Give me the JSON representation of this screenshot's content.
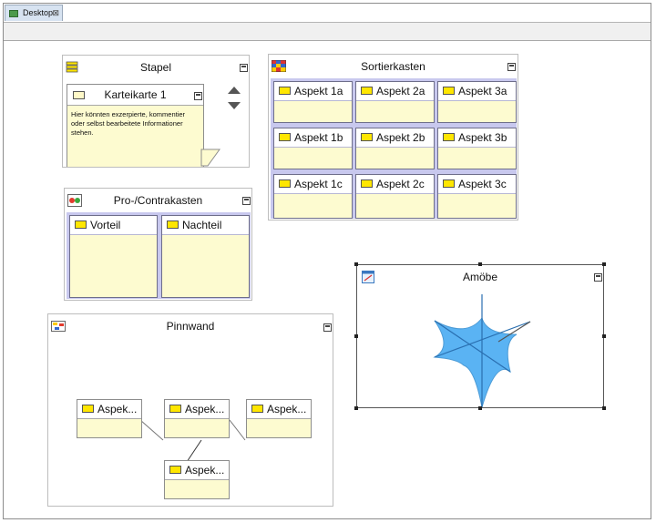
{
  "tab": {
    "label": "Desktop",
    "close": "⊠"
  },
  "stapel": {
    "title": "Stapel",
    "card_title": "Karteikarte 1",
    "card_text_lines": [
      "Hier könnten exzerpierte, kommentier",
      "oder selbst bearbeitete Informationer",
      "stehen."
    ]
  },
  "sortierkasten": {
    "title": "Sortierkasten",
    "cells": [
      [
        "Aspekt 1a",
        "Aspekt 2a",
        "Aspekt 3a"
      ],
      [
        "Aspekt 1b",
        "Aspekt 2b",
        "Aspekt 3b"
      ],
      [
        "Aspekt 1c",
        "Aspekt 2c",
        "Aspekt 3c"
      ]
    ]
  },
  "procontra": {
    "title": "Pro-/Contrakasten",
    "pro": "Vorteil",
    "contra": "Nachteil"
  },
  "pinnwand": {
    "title": "Pinnwand",
    "cards": [
      "Aspek...",
      "Aspek...",
      "Aspek...",
      "Aspek..."
    ]
  },
  "amoebe": {
    "title": "Amöbe",
    "fill_color": "#5ab3f3",
    "line_color": "#2a6fb0"
  },
  "colors": {
    "card_fill": "#fdfbd0",
    "card_icon": "#ffe600",
    "sort_border": "#c8c8ee"
  }
}
